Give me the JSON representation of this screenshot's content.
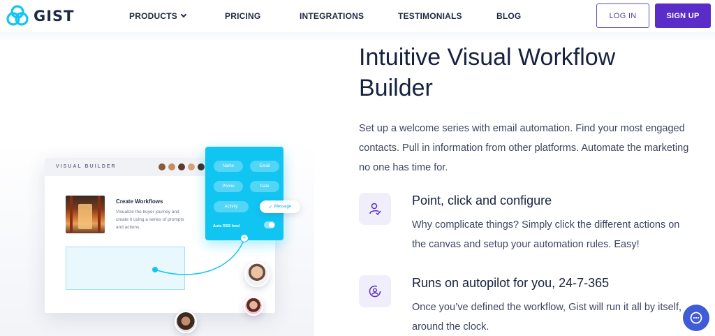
{
  "brand": {
    "name": "GIST",
    "accent": "#11c5f3",
    "primary": "#5a2cc8"
  },
  "nav": {
    "links": [
      {
        "label": "PRODUCTS",
        "has_dropdown": true
      },
      {
        "label": "PRICING"
      },
      {
        "label": "INTEGRATIONS"
      },
      {
        "label": "TESTIMONIALS"
      },
      {
        "label": "BLOG"
      }
    ],
    "login_label": "LOG IN",
    "signup_label": "SIGN UP"
  },
  "hero": {
    "title_line1": "Intuitive Visual Workflow",
    "title_line2": "Builder",
    "description": "Set up a welcome series with email automation. Find your most engaged contacts. Pull in information from other platforms. Automate the marketing no one has time for."
  },
  "features": [
    {
      "icon": "user-check-icon",
      "title": "Point, click and configure",
      "text": "Why complicate things? Simply click the different actions on the canvas and setup your automation rules. Easy!"
    },
    {
      "icon": "user-refresh-icon",
      "title": "Runs on autopilot for you, 24-7-365",
      "text": "Once you’ve defined the workflow, Gist will run it all by itself, around the clock."
    }
  ],
  "illustration": {
    "header_label": "VISUAL BUILDER",
    "card_title": "Create Workflows",
    "card_text": "Visualize the buyer journey and create it using a series of prompts and actions.",
    "pills": [
      "Name",
      "Email",
      "Phone",
      "Date",
      "Activity"
    ],
    "panel_toggle_label": "Auto RSS feed",
    "message_tag": "Message",
    "node_symbol": "+",
    "check_symbol": "✓"
  },
  "chat": {
    "icon": "chat-bubble-icon"
  }
}
